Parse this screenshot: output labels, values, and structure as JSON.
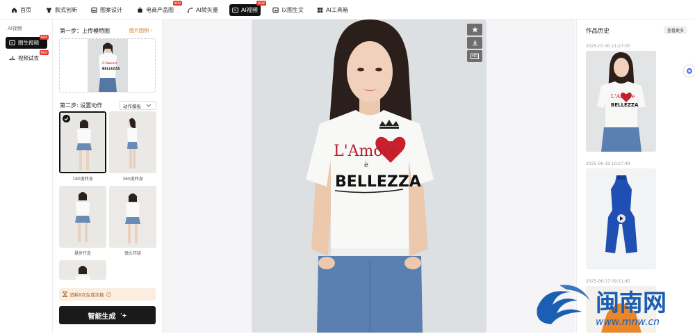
{
  "topnav": {
    "items": [
      {
        "label": "首页",
        "icon": "home-icon"
      },
      {
        "label": "款式创新",
        "icon": "tshirt-icon"
      },
      {
        "label": "图案设计",
        "icon": "image-icon"
      },
      {
        "label": "电商产品图",
        "icon": "bag-icon",
        "badge": "NEW"
      },
      {
        "label": "AI转矢量",
        "icon": "vector-icon"
      },
      {
        "label": "AI视频",
        "icon": "video-icon",
        "badge": "NEW",
        "active": true
      },
      {
        "label": "以图生文",
        "icon": "image-text-icon"
      },
      {
        "label": "AI工具箱",
        "icon": "toolbox-icon"
      }
    ]
  },
  "sidebar": {
    "title": "AI视频",
    "items": [
      {
        "label": "图生视频",
        "badge": "NEW"
      },
      {
        "label": "视频试衣",
        "badge": "NEW"
      }
    ]
  },
  "panel": {
    "step1_title": "第一步：上传模特图",
    "step1_link": "图片图例 ›",
    "step2_title": "第二步: 设置动作",
    "motion_select": "动作模板",
    "motions": [
      "180度转身",
      "360度转身",
      "悬步行走",
      "镜头环绕"
    ],
    "cost_notice": "消耗8次生成次数",
    "generate_label": "智能生成"
  },
  "preview": {
    "shirt_text_top": "L'Amore",
    "shirt_text_mid": "è",
    "shirt_text_bottom": "BELLEZZA",
    "tools": [
      "star-icon",
      "download-icon",
      "hd-icon"
    ],
    "hd_label": "HD"
  },
  "history": {
    "title": "作品历史",
    "see_more": "查看更多",
    "entries": [
      {
        "date": "2025-07-30 11:27:00"
      },
      {
        "date": "2025-06-19 10:27:49"
      },
      {
        "date": "2025-06-17 09:11:45"
      }
    ]
  },
  "watermark": {
    "text": "闽南网",
    "url": "www.mnw.cn"
  },
  "colors": {
    "accent_dark": "#111111",
    "badge_red": "#e7372e",
    "link_orange": "#e07a1f",
    "watermark_blue": "#1a5fb4"
  }
}
